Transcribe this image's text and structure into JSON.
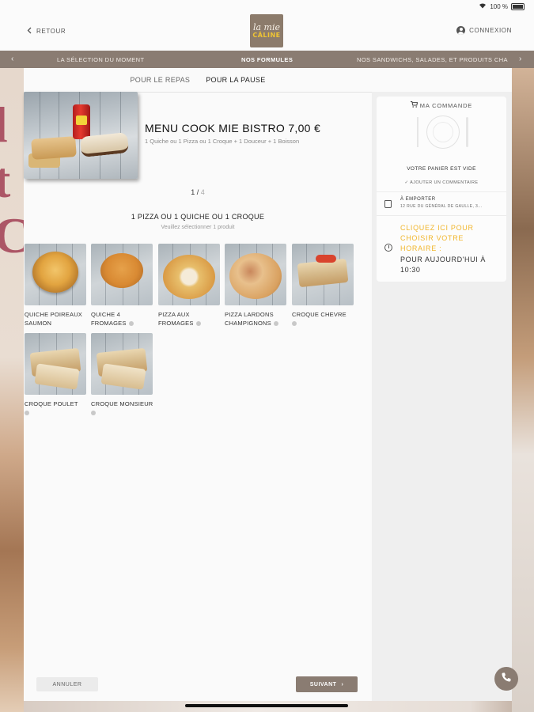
{
  "status_bar": {
    "battery": "100 %"
  },
  "header": {
    "back_label": "RETOUR",
    "logo_line1": "la mie",
    "logo_line2": "CÂLINE",
    "login_label": "CONNEXION"
  },
  "category_nav": {
    "items": [
      {
        "label": "LA SÉLECTION DU MOMENT"
      },
      {
        "label": "NOS FORMULES"
      },
      {
        "label": "NOS SANDWICHS, SALADES, ET PRODUITS CHA"
      }
    ],
    "active_index": 1
  },
  "sub_tabs": [
    {
      "label": "POUR LE REPAS"
    },
    {
      "label": "POUR LA PAUSE"
    }
  ],
  "menu": {
    "title": "MENU COOK MIE BISTRO 7,00 €",
    "description": "1 Quiche ou 1 Pizza ou 1 Croque + 1 Douceur + 1 Boisson"
  },
  "pager": {
    "current": "1",
    "sep": "/",
    "total": "4"
  },
  "step": {
    "title": "1 PIZZA OU 1 QUICHE OU 1 CROQUE",
    "subtitle": "Veuillez sélectionner 1 produit"
  },
  "products": [
    {
      "name": "QUICHE POIREAUX SAUMON"
    },
    {
      "name": "QUICHE 4 FROMAGES"
    },
    {
      "name": "PIZZA AUX FROMAGES"
    },
    {
      "name": "PIZZA LARDONS CHAMPIGNONS"
    },
    {
      "name": "CROQUE CHEVRE"
    },
    {
      "name": "CROQUE POULET"
    },
    {
      "name": "CROQUE MONSIEUR"
    }
  ],
  "buttons": {
    "cancel": "ANNULER",
    "next": "SUIVANT"
  },
  "order": {
    "title": "MA COMMANDE",
    "empty": "VOTRE PANIER EST VIDE",
    "add_comment": "✓ AJOUTER UN COMMENTAIRE",
    "takeaway_title": "À EMPORTER",
    "takeaway_address": "12 RUE DU GÉNÉRAL DE GAULLE, 3...",
    "time_cta": "CLIQUEZ ICI POUR CHOISIR VOTRE HORAIRE :",
    "time_prefix": "POUR",
    "time_value": "AUJOURD'HUI À 10:30"
  },
  "colors": {
    "brand_taupe": "#8a7c72",
    "accent_yellow": "#f1b62d"
  }
}
